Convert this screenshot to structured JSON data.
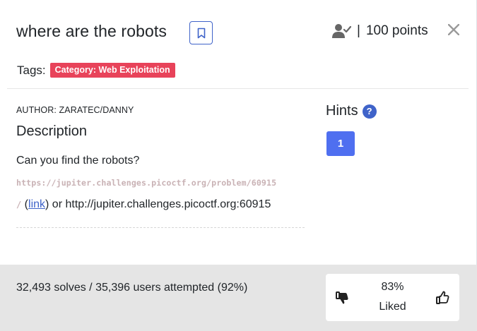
{
  "challenge": {
    "title": "where are the robots",
    "points": "100 points",
    "separator": "|",
    "tags_label": "Tags:",
    "tags": [
      "Category: Web Exploitation"
    ],
    "author": "AUTHOR: ZARATEC/DANNY",
    "description_heading": "Description",
    "description_text": "Can you find the robots?",
    "url_code": "https://jupiter.challenges.picoctf.org/problem/60915",
    "url_code_tail": "/",
    "link_open": " (",
    "link_text": "link",
    "link_close": ") or http://jupiter.challenges.picoctf.org:60915"
  },
  "hints": {
    "heading": "Hints",
    "help_glyph": "?",
    "items": [
      "1"
    ]
  },
  "footer": {
    "solves_text": "32,493 solves / 35,396 users attempted (92%)",
    "like_percent": "83%",
    "like_label": "Liked"
  },
  "icons": {
    "bookmark": "bookmark-icon",
    "user_check": "user-check-icon",
    "close": "close-icon",
    "help": "help-icon",
    "thumbs_down": "thumbs-down-icon",
    "thumbs_up": "thumbs-up-icon"
  },
  "colors": {
    "accent": "#3f63c9",
    "tag": "#e8435a",
    "hint_button": "#4f6ff0",
    "footer_bg": "#e5e5e5"
  }
}
